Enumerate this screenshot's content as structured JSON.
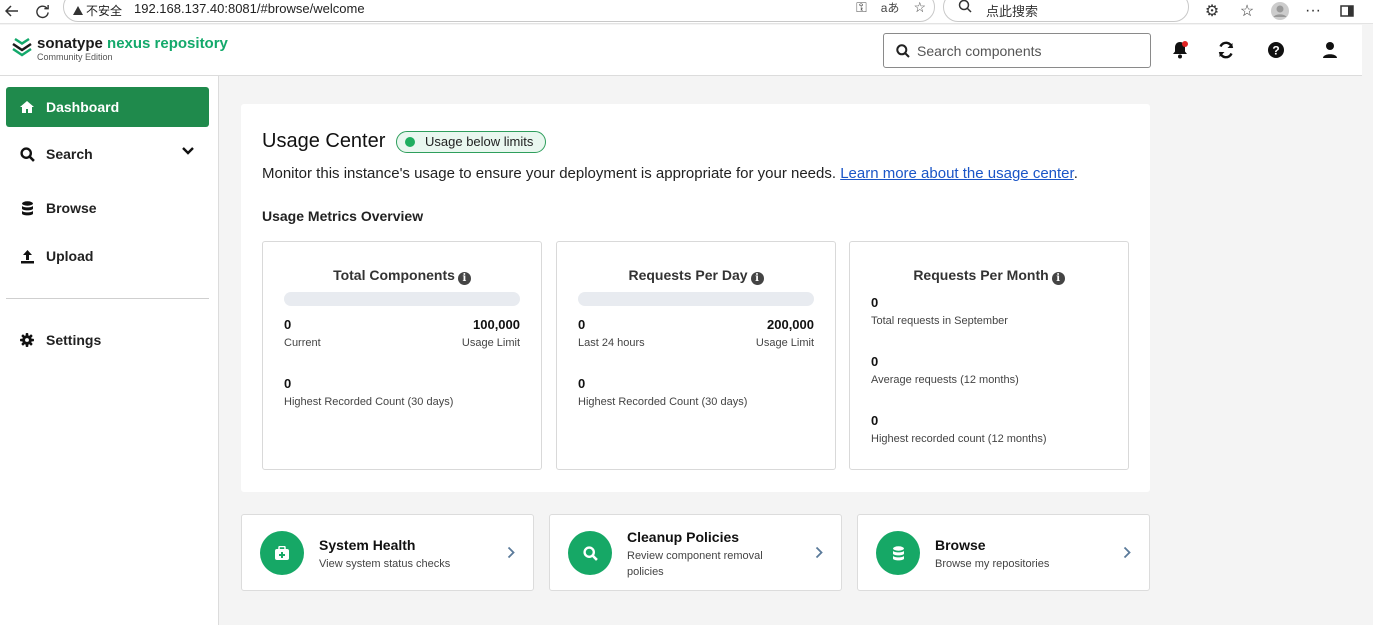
{
  "browser": {
    "security_label": "不安全",
    "url": "192.168.137.40:8081/#browse/welcome",
    "search_text": "点此搜索"
  },
  "header": {
    "brand_main": "sonatype",
    "brand_product": "nexus repository",
    "edition": "Community Edition",
    "search_placeholder": "Search components"
  },
  "sidebar": {
    "items": [
      {
        "label": "Dashboard",
        "icon": "home-icon",
        "active": true
      },
      {
        "label": "Search",
        "icon": "search-icon"
      },
      {
        "label": "Browse",
        "icon": "database-icon"
      },
      {
        "label": "Upload",
        "icon": "upload-icon"
      },
      {
        "label": "Settings",
        "icon": "gear-icon"
      }
    ]
  },
  "usage": {
    "title": "Usage Center",
    "badge": "Usage below limits",
    "desc_prefix": "Monitor this instance's usage to ensure your deployment is appropriate for your needs. ",
    "desc_link": "Learn more about the usage center",
    "desc_suffix": ".",
    "overview_title": "Usage Metrics Overview",
    "cards": [
      {
        "title": "Total Components",
        "progress": 0,
        "current": "0",
        "current_label": "Current",
        "limit": "100,000",
        "limit_label": "Usage Limit",
        "highest": "0",
        "highest_label": "Highest Recorded Count (30 days)"
      },
      {
        "title": "Requests Per Day",
        "progress": 0,
        "current": "0",
        "current_label": "Last 24 hours",
        "limit": "200,000",
        "limit_label": "Usage Limit",
        "highest": "0",
        "highest_label": "Highest Recorded Count (30 days)"
      },
      {
        "title": "Requests Per Month",
        "stats": [
          {
            "value": "0",
            "label": "Total requests in September"
          },
          {
            "value": "0",
            "label": "Average requests (12 months)"
          },
          {
            "value": "0",
            "label": "Highest recorded count (12 months)"
          }
        ]
      }
    ]
  },
  "links": [
    {
      "title": "System Health",
      "desc": "View system status checks",
      "icon": "medkit-icon"
    },
    {
      "title": "Cleanup Policies",
      "desc": "Review component removal policies",
      "icon": "search-icon"
    },
    {
      "title": "Browse",
      "desc": "Browse my repositories",
      "icon": "database-icon"
    }
  ],
  "colors": {
    "brand_green": "#13a96b",
    "active_nav": "#1f8a4c",
    "link_blue": "#1a55c7",
    "badge_dot": "#1fae5f"
  }
}
